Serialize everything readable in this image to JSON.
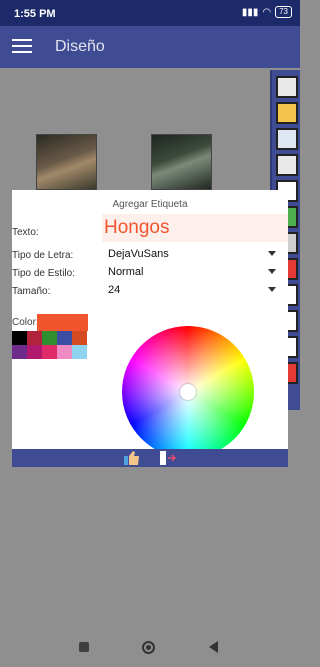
{
  "status_bar": {
    "time": "1:55 PM",
    "battery": "73"
  },
  "app_bar": {
    "title": "Diseño"
  },
  "dialog": {
    "title": "Agregar Etiqueta",
    "text_label": "Texto:",
    "text_value": "Hongos",
    "font_label": "Tipo de Letra:",
    "font_value": "DejaVuSans",
    "style_label": "Tipo de Estilo:",
    "style_value": "Normal",
    "size_label": "Tamaño:",
    "size_value": "24",
    "color_label": "Color:",
    "selected_color": "#f0552d",
    "swatches": [
      "#000000",
      "#b2233b",
      "#2f8f2f",
      "#3b4ea3",
      "#d64a22",
      "#6d2c8c",
      "#b0196e",
      "#e02a6a",
      "#f08ac2",
      "#8ed4f0"
    ]
  },
  "side_toolbar": {
    "icons": [
      "frame-icon",
      "gallery-icon",
      "save-icon",
      "image-icon",
      "circle-icon",
      "green-icon",
      "gray-icon",
      "red-icon",
      "pencil-icon",
      "share-icon",
      "info-icon",
      "close-icon"
    ]
  }
}
